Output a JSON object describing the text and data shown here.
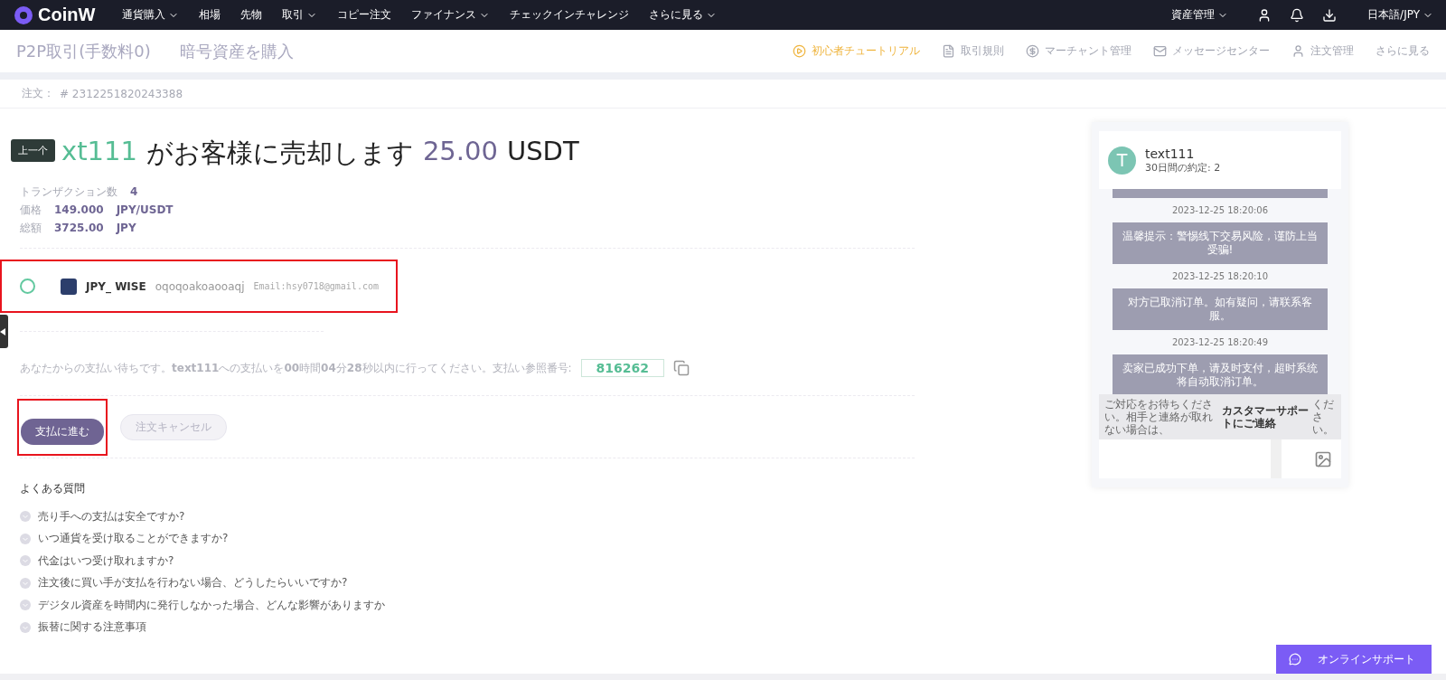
{
  "topnav": {
    "logo": "CoinW",
    "items": [
      {
        "label": "通貨購入",
        "dropdown": true
      },
      {
        "label": "相場",
        "dropdown": false
      },
      {
        "label": "先物",
        "dropdown": false
      },
      {
        "label": "取引",
        "dropdown": true
      },
      {
        "label": "コピー注文",
        "dropdown": false
      },
      {
        "label": "ファイナンス",
        "dropdown": true
      },
      {
        "label": "チェックインチャレンジ",
        "dropdown": false
      },
      {
        "label": "さらに見る",
        "dropdown": true
      }
    ],
    "asset": "資産管理",
    "language": "日本語/JPY"
  },
  "subheader": {
    "title": "P2P取引(手数料0)",
    "subtitle": "暗号資産を購入",
    "links": [
      {
        "label": "初心者チュートリアル",
        "kind": "tutorial",
        "highlighted": true
      },
      {
        "label": "取引規則",
        "kind": "rules",
        "highlighted": false
      },
      {
        "label": "マーチャント管理",
        "kind": "merchant",
        "highlighted": false
      },
      {
        "label": "メッセージセンター",
        "kind": "message",
        "highlighted": false
      },
      {
        "label": "注文管理",
        "kind": "orders",
        "highlighted": false
      },
      {
        "label": "さらに見る",
        "kind": "more",
        "highlighted": false
      }
    ]
  },
  "order": {
    "label": "注文：",
    "number": "# 2312251820243388"
  },
  "tooltip": "上一个",
  "headline": {
    "seller": "xt111",
    "verb": "がお客様に売却します",
    "amount": "25.00",
    "unit": "USDT"
  },
  "stats": [
    {
      "label": "トランザクション数",
      "value": "4"
    },
    {
      "label": "価格",
      "value": "149.000",
      "unit": "JPY/USDT"
    },
    {
      "label": "総額",
      "value": "3725.00",
      "unit": "JPY"
    }
  ],
  "payment_method": {
    "selected": false,
    "name": "JPY_ WISE",
    "account": "oqoqoakoaooaqj",
    "detail": "Email:hsy0718@gmail.com"
  },
  "payment_notice": {
    "text": "あなたからの支払い待ちです。**text111**への支払いを**00**時間**04**分**28**秒以内に行ってください。支払い参照番号:",
    "reference": "816262"
  },
  "buttons": [
    {
      "label": "支払に進む",
      "kind": "primary"
    },
    {
      "label": "注文キャンセル",
      "kind": "secondary"
    }
  ],
  "faq": {
    "title": "よくある質問",
    "items": [
      "売り手への支払は安全ですか?",
      "いつ通貨を受け取ることができますか?",
      "代金はいつ受け取れますか?",
      "注文後に買い手が支払を行わない場合、どうしたらいいですか?",
      "デジタル資産を時間内に発行しなかった場合、どんな影響がありますか",
      "振替に関する注意事項"
    ]
  },
  "chat": {
    "avatar": "T",
    "name": "text111",
    "subtitle": "30日間の約定: 2",
    "messages": [
      {
        "time": "2023-12-25 18:20:06",
        "text": "温馨提示：警惕线下交易风险，谨防上当受骗!"
      },
      {
        "time": "2023-12-25 18:20:10",
        "text": "对方已取消订单。如有疑问，请联系客服。"
      },
      {
        "time": "2023-12-25 18:20:49",
        "text": "卖家已成功下单，请及时支付，超时系统将自动取消订单。"
      }
    ],
    "notice": {
      "text": "ご対応をお待ちください。相手と連絡が取れない場合は、",
      "link": "カスタマーサポートにご連絡",
      "tail": "ください。"
    }
  },
  "support": "オンラインサポート"
}
